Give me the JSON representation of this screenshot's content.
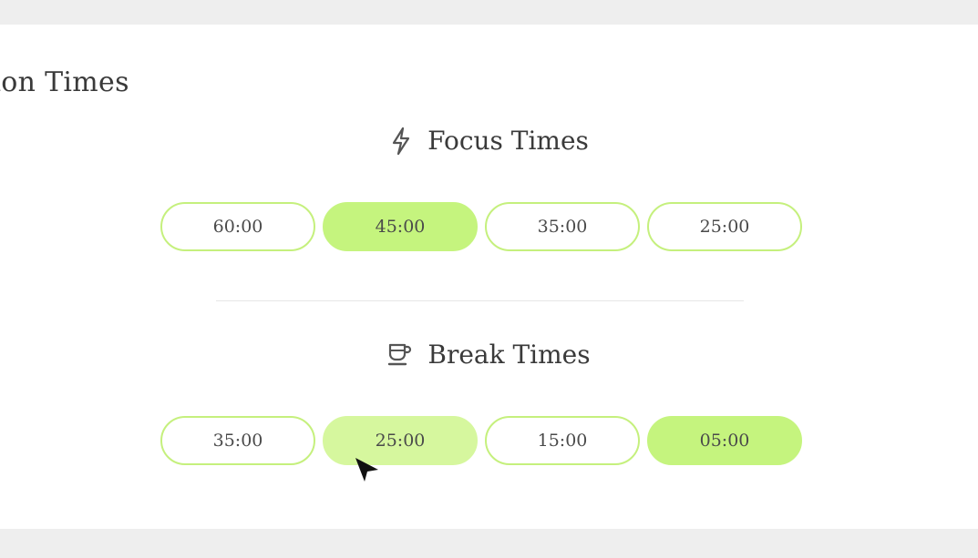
{
  "section": {
    "title": "ssion Times"
  },
  "focus": {
    "heading": "Focus Times",
    "icon": "lightning-bolt-icon",
    "options": [
      {
        "label": "60:00",
        "state": "default"
      },
      {
        "label": "45:00",
        "state": "selected"
      },
      {
        "label": "35:00",
        "state": "default"
      },
      {
        "label": "25:00",
        "state": "default"
      }
    ]
  },
  "break": {
    "heading": "Break Times",
    "icon": "coffee-cup-icon",
    "options": [
      {
        "label": "35:00",
        "state": "default"
      },
      {
        "label": "25:00",
        "state": "hovered"
      },
      {
        "label": "15:00",
        "state": "default"
      },
      {
        "label": "05:00",
        "state": "selected"
      }
    ]
  },
  "colors": {
    "accent": "#c5f47e",
    "accent_border": "#c5f07d",
    "hover": "#d6f79e",
    "background": "#eeeeee",
    "card": "#ffffff"
  }
}
